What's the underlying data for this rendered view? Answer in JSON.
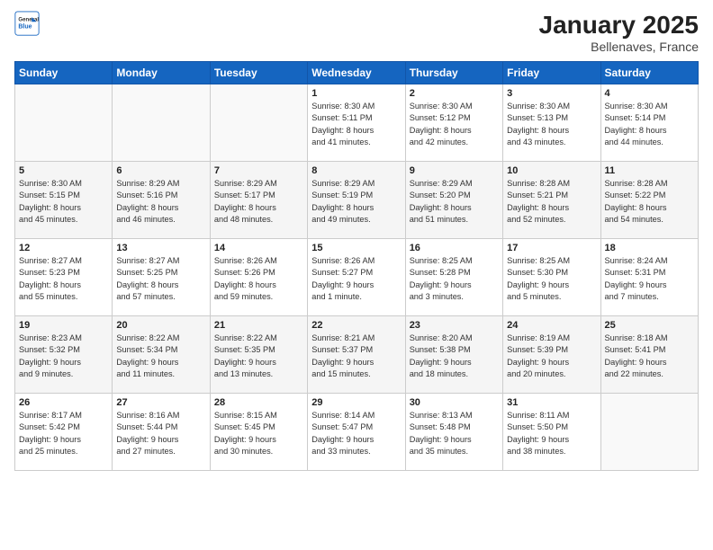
{
  "logo": {
    "general": "General",
    "blue": "Blue"
  },
  "header": {
    "title": "January 2025",
    "location": "Bellenaves, France"
  },
  "weekdays": [
    "Sunday",
    "Monday",
    "Tuesday",
    "Wednesday",
    "Thursday",
    "Friday",
    "Saturday"
  ],
  "weeks": [
    [
      {
        "day": "",
        "info": ""
      },
      {
        "day": "",
        "info": ""
      },
      {
        "day": "",
        "info": ""
      },
      {
        "day": "1",
        "info": "Sunrise: 8:30 AM\nSunset: 5:11 PM\nDaylight: 8 hours\nand 41 minutes."
      },
      {
        "day": "2",
        "info": "Sunrise: 8:30 AM\nSunset: 5:12 PM\nDaylight: 8 hours\nand 42 minutes."
      },
      {
        "day": "3",
        "info": "Sunrise: 8:30 AM\nSunset: 5:13 PM\nDaylight: 8 hours\nand 43 minutes."
      },
      {
        "day": "4",
        "info": "Sunrise: 8:30 AM\nSunset: 5:14 PM\nDaylight: 8 hours\nand 44 minutes."
      }
    ],
    [
      {
        "day": "5",
        "info": "Sunrise: 8:30 AM\nSunset: 5:15 PM\nDaylight: 8 hours\nand 45 minutes."
      },
      {
        "day": "6",
        "info": "Sunrise: 8:29 AM\nSunset: 5:16 PM\nDaylight: 8 hours\nand 46 minutes."
      },
      {
        "day": "7",
        "info": "Sunrise: 8:29 AM\nSunset: 5:17 PM\nDaylight: 8 hours\nand 48 minutes."
      },
      {
        "day": "8",
        "info": "Sunrise: 8:29 AM\nSunset: 5:19 PM\nDaylight: 8 hours\nand 49 minutes."
      },
      {
        "day": "9",
        "info": "Sunrise: 8:29 AM\nSunset: 5:20 PM\nDaylight: 8 hours\nand 51 minutes."
      },
      {
        "day": "10",
        "info": "Sunrise: 8:28 AM\nSunset: 5:21 PM\nDaylight: 8 hours\nand 52 minutes."
      },
      {
        "day": "11",
        "info": "Sunrise: 8:28 AM\nSunset: 5:22 PM\nDaylight: 8 hours\nand 54 minutes."
      }
    ],
    [
      {
        "day": "12",
        "info": "Sunrise: 8:27 AM\nSunset: 5:23 PM\nDaylight: 8 hours\nand 55 minutes."
      },
      {
        "day": "13",
        "info": "Sunrise: 8:27 AM\nSunset: 5:25 PM\nDaylight: 8 hours\nand 57 minutes."
      },
      {
        "day": "14",
        "info": "Sunrise: 8:26 AM\nSunset: 5:26 PM\nDaylight: 8 hours\nand 59 minutes."
      },
      {
        "day": "15",
        "info": "Sunrise: 8:26 AM\nSunset: 5:27 PM\nDaylight: 9 hours\nand 1 minute."
      },
      {
        "day": "16",
        "info": "Sunrise: 8:25 AM\nSunset: 5:28 PM\nDaylight: 9 hours\nand 3 minutes."
      },
      {
        "day": "17",
        "info": "Sunrise: 8:25 AM\nSunset: 5:30 PM\nDaylight: 9 hours\nand 5 minutes."
      },
      {
        "day": "18",
        "info": "Sunrise: 8:24 AM\nSunset: 5:31 PM\nDaylight: 9 hours\nand 7 minutes."
      }
    ],
    [
      {
        "day": "19",
        "info": "Sunrise: 8:23 AM\nSunset: 5:32 PM\nDaylight: 9 hours\nand 9 minutes."
      },
      {
        "day": "20",
        "info": "Sunrise: 8:22 AM\nSunset: 5:34 PM\nDaylight: 9 hours\nand 11 minutes."
      },
      {
        "day": "21",
        "info": "Sunrise: 8:22 AM\nSunset: 5:35 PM\nDaylight: 9 hours\nand 13 minutes."
      },
      {
        "day": "22",
        "info": "Sunrise: 8:21 AM\nSunset: 5:37 PM\nDaylight: 9 hours\nand 15 minutes."
      },
      {
        "day": "23",
        "info": "Sunrise: 8:20 AM\nSunset: 5:38 PM\nDaylight: 9 hours\nand 18 minutes."
      },
      {
        "day": "24",
        "info": "Sunrise: 8:19 AM\nSunset: 5:39 PM\nDaylight: 9 hours\nand 20 minutes."
      },
      {
        "day": "25",
        "info": "Sunrise: 8:18 AM\nSunset: 5:41 PM\nDaylight: 9 hours\nand 22 minutes."
      }
    ],
    [
      {
        "day": "26",
        "info": "Sunrise: 8:17 AM\nSunset: 5:42 PM\nDaylight: 9 hours\nand 25 minutes."
      },
      {
        "day": "27",
        "info": "Sunrise: 8:16 AM\nSunset: 5:44 PM\nDaylight: 9 hours\nand 27 minutes."
      },
      {
        "day": "28",
        "info": "Sunrise: 8:15 AM\nSunset: 5:45 PM\nDaylight: 9 hours\nand 30 minutes."
      },
      {
        "day": "29",
        "info": "Sunrise: 8:14 AM\nSunset: 5:47 PM\nDaylight: 9 hours\nand 33 minutes."
      },
      {
        "day": "30",
        "info": "Sunrise: 8:13 AM\nSunset: 5:48 PM\nDaylight: 9 hours\nand 35 minutes."
      },
      {
        "day": "31",
        "info": "Sunrise: 8:11 AM\nSunset: 5:50 PM\nDaylight: 9 hours\nand 38 minutes."
      },
      {
        "day": "",
        "info": ""
      }
    ]
  ]
}
